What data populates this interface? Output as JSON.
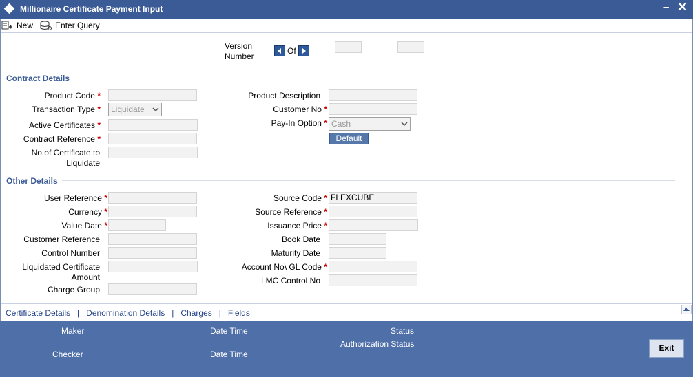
{
  "window": {
    "title": "Millionaire Certificate Payment Input"
  },
  "toolbar": {
    "new_label": "New",
    "enter_query_label": "Enter Query"
  },
  "version": {
    "label_line1": "Version",
    "label_line2": "Number",
    "of_label": "Of"
  },
  "contract": {
    "section_title": "Contract Details",
    "product_code_label": "Product Code",
    "transaction_type_label": "Transaction Type",
    "transaction_type_value": "Liquidate",
    "active_certificates_label": "Active Certificates",
    "contract_reference_label": "Contract Reference",
    "no_cert_label_line1": "No of Certificate to",
    "no_cert_label_line2": "Liquidate",
    "product_description_label": "Product Description",
    "customer_no_label": "Customer No",
    "pay_in_option_label": "Pay-In Option",
    "pay_in_option_value": "Cash",
    "default_button": "Default"
  },
  "other": {
    "section_title": "Other Details",
    "user_reference_label": "User Reference",
    "currency_label": "Currency",
    "value_date_label": "Value Date",
    "customer_reference_label": "Customer Reference",
    "control_number_label": "Control Number",
    "liquidated_amount_line1": "Liquidated Certificate",
    "liquidated_amount_line2": "Amount",
    "charge_group_label": "Charge Group",
    "source_code_label": "Source Code",
    "source_code_value": "FLEXCUBE",
    "source_reference_label": "Source Reference",
    "issuance_price_label": "Issuance Price",
    "book_date_label": "Book Date",
    "maturity_date_label": "Maturity Date",
    "account_gl_label": "Account No\\ GL Code",
    "lmc_control_label": "LMC Control No"
  },
  "tabs": [
    "Certificate Details",
    "Denomination Details",
    "Charges",
    "Fields"
  ],
  "tab_separator": "|",
  "required_marker": "*",
  "footer": {
    "maker": "Maker",
    "checker": "Checker",
    "date_time_1": "Date Time",
    "date_time_2": "Date Time",
    "status": "Status",
    "authorization_status": "Authorization Status",
    "exit": "Exit"
  },
  "colors": {
    "titlebar": "#3a5b96",
    "footer": "#4e6fa8",
    "section": "#3a5b96",
    "required": "#cc0000",
    "link": "#1f3f86"
  }
}
